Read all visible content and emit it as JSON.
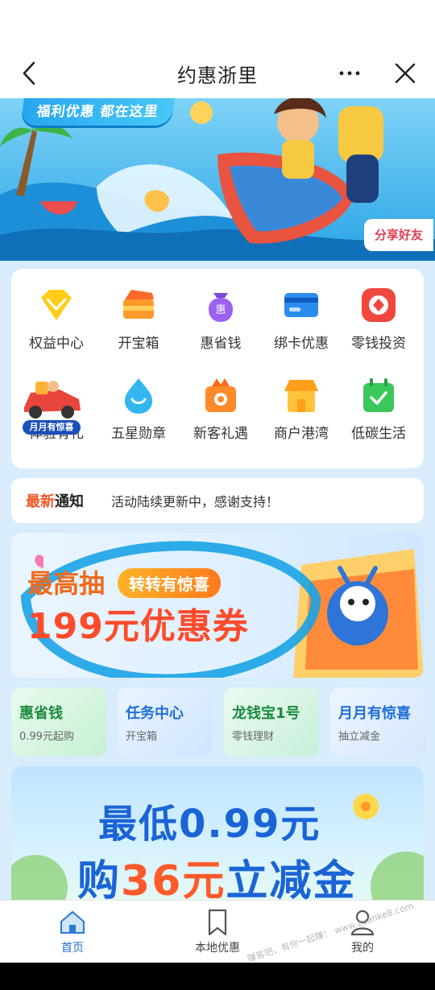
{
  "header": {
    "title": "约惠浙里"
  },
  "hero": {
    "tag": "福利优惠 都在这里",
    "share": "分享好友"
  },
  "menu": [
    {
      "label": "权益中心",
      "icon": "diamond-icon"
    },
    {
      "label": "开宝箱",
      "icon": "treasure-box-icon"
    },
    {
      "label": "惠省钱",
      "icon": "money-bag-icon"
    },
    {
      "label": "绑卡优惠",
      "icon": "bank-card-icon"
    },
    {
      "label": "零钱投资",
      "icon": "coin-icon"
    },
    {
      "label": "体验有礼",
      "icon": "gift-car-icon"
    },
    {
      "label": "五星勋章",
      "icon": "medal-icon"
    },
    {
      "label": "新客礼遇",
      "icon": "new-customer-gift-icon"
    },
    {
      "label": "商户港湾",
      "icon": "merchant-store-icon"
    },
    {
      "label": "低碳生活",
      "icon": "eco-calendar-icon"
    }
  ],
  "float": {
    "label": "月月有惊喜"
  },
  "notice": {
    "tag_a": "最新",
    "tag_b": "通知",
    "message": "活动陆续更新中，感谢支持！"
  },
  "promo": {
    "line1": "最高抽",
    "pill": "转转有惊喜",
    "line2": "199元优惠券"
  },
  "minis": [
    {
      "title": "惠省钱",
      "sub": "0.99元起购"
    },
    {
      "title": "任务中心",
      "sub": "开宝箱"
    },
    {
      "title": "龙钱宝1号",
      "sub": "零钱理财"
    },
    {
      "title": "月月有惊喜",
      "sub": "抽立减金"
    }
  ],
  "banner": {
    "line1": "最低0.99元",
    "line2_pre": "购",
    "line2_num": "36元",
    "line2_post": "立减金"
  },
  "tabs": [
    {
      "label": "首页",
      "active": true
    },
    {
      "label": "本地优惠",
      "active": false
    },
    {
      "label": "我的",
      "active": false
    }
  ],
  "watermark": "赚客吧，有你一起赚！ www.zuanke8.com",
  "colors": {
    "accent": "#1f7fd6",
    "orange": "#f06a1b",
    "active_tab": "#1f7fd6"
  }
}
